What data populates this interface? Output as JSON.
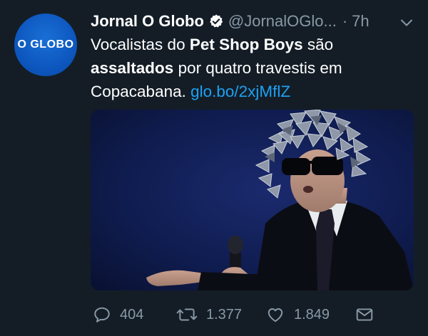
{
  "avatar": {
    "label": "O GLOBO",
    "color": "#1062cf"
  },
  "header": {
    "author_name": "Jornal O Globo",
    "handle": "@JornalOGlo...",
    "separator": "·",
    "time": "7h"
  },
  "tweet": {
    "text_1": "Vocalistas do ",
    "bold_1": "Pet Shop Boys",
    "text_2": " são ",
    "bold_2": "assaltados",
    "text_3": " por quatro travestis em Copacabana. ",
    "link": "glo.bo/2xjMflZ"
  },
  "actions": {
    "replies": "404",
    "retweets": "1.377",
    "likes": "1.849"
  },
  "colors": {
    "background": "#141d26",
    "secondary_text": "#8899a6",
    "link": "#1da1f2"
  },
  "icons": [
    "verified-badge-icon",
    "chevron-down-icon",
    "reply-icon",
    "retweet-icon",
    "heart-icon",
    "envelope-icon"
  ]
}
